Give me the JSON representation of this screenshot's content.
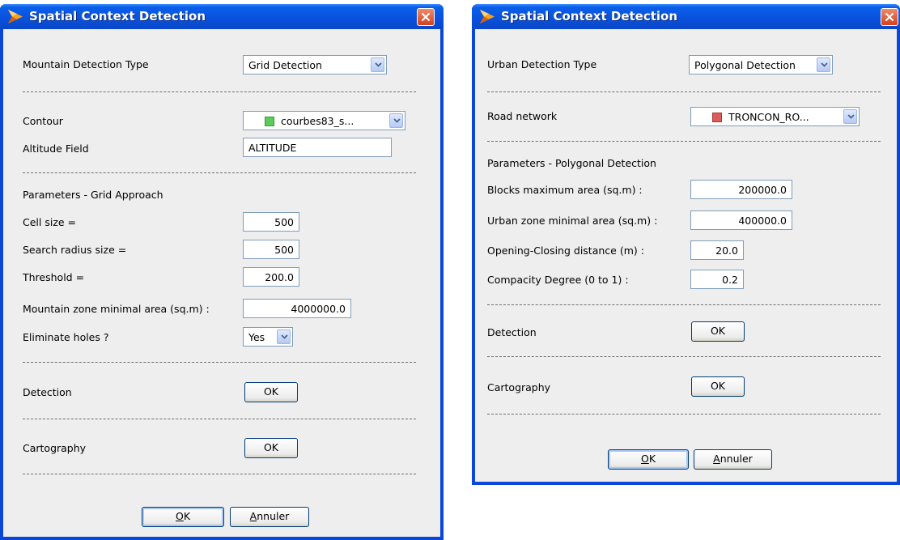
{
  "left_dialog": {
    "title": "Spatial Context Detection",
    "icons": {
      "title": "app-logo-icon",
      "close": "close-icon"
    },
    "detection_type": {
      "label": "Mountain Detection Type",
      "value": "Grid Detection"
    },
    "contour": {
      "label": "Contour",
      "value": "courbes83_s...",
      "swatch_color": "#5ccb5c"
    },
    "altitude_field": {
      "label": "Altitude Field",
      "value": "ALTITUDE"
    },
    "params_title": "Parameters - Grid Approach",
    "cell_size": {
      "label": "Cell size =",
      "value": "500"
    },
    "search_radius": {
      "label": "Search radius size =",
      "value": "500"
    },
    "threshold": {
      "label": "Threshold =",
      "value": "200.0"
    },
    "min_area": {
      "label": "Mountain zone minimal area (sq.m) :",
      "value": "4000000.0"
    },
    "eliminate_holes": {
      "label": "Eliminate holes ?",
      "value": "Yes"
    },
    "detection": {
      "label": "Detection",
      "button": "OK"
    },
    "cartography": {
      "label": "Cartography",
      "button": "OK"
    },
    "footer": {
      "ok_prefix": "",
      "ok_mnemonic": "O",
      "ok_rest": "K",
      "cancel_mnemonic": "A",
      "cancel_rest": "nnuler"
    }
  },
  "right_dialog": {
    "title": "Spatial Context Detection",
    "icons": {
      "title": "app-logo-icon",
      "close": "close-icon"
    },
    "detection_type": {
      "label": "Urban Detection Type",
      "value": "Polygonal Detection"
    },
    "road_network": {
      "label": "Road network",
      "value": "TRONCON_RO...",
      "swatch_color": "#dc5a5a"
    },
    "params_title": "Parameters - Polygonal Detection",
    "blocks_max_area": {
      "label": "Blocks maximum area (sq.m) :",
      "value": "200000.0"
    },
    "urban_min_area": {
      "label": "Urban zone minimal area (sq.m) :",
      "value": "400000.0"
    },
    "opening_closing": {
      "label": "Opening-Closing distance (m) :",
      "value": "20.0"
    },
    "compacity": {
      "label": "Compacity Degree (0 to 1) :",
      "value": "0.2"
    },
    "detection": {
      "label": "Detection",
      "button": "OK"
    },
    "cartography": {
      "label": "Cartography",
      "button": "OK"
    },
    "footer": {
      "ok_mnemonic": "O",
      "ok_rest": "K",
      "cancel_mnemonic": "A",
      "cancel_rest": "nnuler"
    }
  },
  "colors": {
    "title_bar": "#0a52de",
    "client": "#eeeeee",
    "close": "#d4401c"
  }
}
